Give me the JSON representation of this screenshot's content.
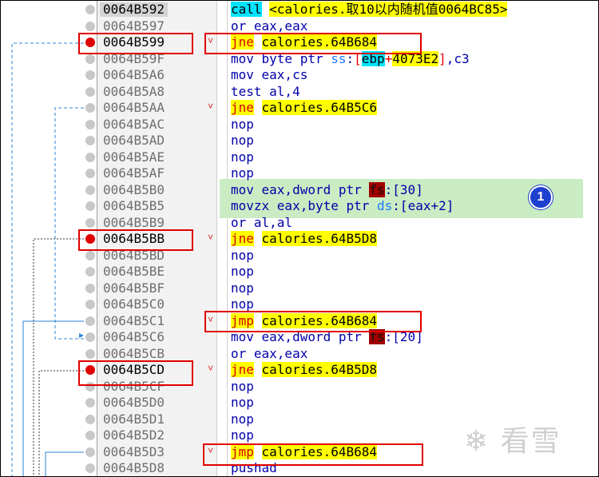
{
  "disasm": {
    "rows": [
      {
        "addr": "0064B592",
        "bp": "grey",
        "cur": true,
        "mark": "",
        "ins": [
          {
            "t": "call",
            "c": "call"
          },
          {
            "t": " ",
            "c": "plain"
          },
          {
            "t": "<calories.取10以内随机值0064BC85>",
            "c": "tgt"
          }
        ]
      },
      {
        "addr": "0064B597",
        "bp": "grey",
        "mark": "",
        "ins": [
          {
            "t": "or eax,eax",
            "c": "m"
          }
        ]
      },
      {
        "addr": "0064B599",
        "bp": "red",
        "mark": "˅",
        "ins": [
          {
            "t": "jne",
            "c": "jmp"
          },
          {
            "t": " ",
            "c": "plain"
          },
          {
            "t": "calories.64B684",
            "c": "tgt2"
          }
        ]
      },
      {
        "addr": "0064B59F",
        "bp": "grey",
        "mark": "",
        "ins": [
          {
            "t": "mov byte ptr ",
            "c": "m"
          },
          {
            "t": "ss",
            "c": "seg"
          },
          {
            "t": ":",
            "c": "m"
          },
          {
            "t": "[",
            "c": "br"
          },
          {
            "t": "ebp",
            "c": "reg"
          },
          {
            "t": "+",
            "c": "br"
          },
          {
            "t": "4073E2",
            "c": "off"
          },
          {
            "t": "]",
            "c": "br"
          },
          {
            "t": ",c3",
            "c": "m"
          }
        ]
      },
      {
        "addr": "0064B5A6",
        "bp": "grey",
        "mark": "",
        "ins": [
          {
            "t": "mov eax,cs",
            "c": "m"
          }
        ]
      },
      {
        "addr": "0064B5A8",
        "bp": "grey",
        "mark": "",
        "ins": [
          {
            "t": "test al,4",
            "c": "m"
          }
        ]
      },
      {
        "addr": "0064B5AA",
        "bp": "grey",
        "mark": "˅",
        "ins": [
          {
            "t": "jne",
            "c": "jmp"
          },
          {
            "t": " ",
            "c": "plain"
          },
          {
            "t": "calories.64B5C6",
            "c": "tgt2"
          }
        ]
      },
      {
        "addr": "0064B5AC",
        "bp": "grey",
        "mark": "",
        "ins": [
          {
            "t": "nop",
            "c": "m"
          }
        ]
      },
      {
        "addr": "0064B5AD",
        "bp": "grey",
        "mark": "",
        "ins": [
          {
            "t": "nop",
            "c": "m"
          }
        ]
      },
      {
        "addr": "0064B5AE",
        "bp": "grey",
        "mark": "",
        "ins": [
          {
            "t": "nop",
            "c": "m"
          }
        ]
      },
      {
        "addr": "0064B5AF",
        "bp": "grey",
        "mark": "",
        "ins": [
          {
            "t": "nop",
            "c": "m"
          }
        ]
      },
      {
        "addr": "0064B5B0",
        "bp": "grey",
        "mark": "",
        "ins": [
          {
            "t": "mov eax,dword ptr ",
            "c": "m"
          },
          {
            "t": "fs",
            "c": "fs"
          },
          {
            "t": ":[30]",
            "c": "m"
          }
        ]
      },
      {
        "addr": "0064B5B5",
        "bp": "grey",
        "mark": "",
        "ins": [
          {
            "t": "movzx eax,byte ptr ",
            "c": "m"
          },
          {
            "t": "ds",
            "c": "seg"
          },
          {
            "t": ":[eax+2]",
            "c": "m"
          }
        ]
      },
      {
        "addr": "0064B5B9",
        "bp": "grey",
        "mark": "",
        "ins": [
          {
            "t": "or al,al",
            "c": "m"
          }
        ]
      },
      {
        "addr": "0064B5BB",
        "bp": "red",
        "mark": "˅",
        "ins": [
          {
            "t": "jne",
            "c": "jmp"
          },
          {
            "t": " ",
            "c": "plain"
          },
          {
            "t": "calories.64B5D8",
            "c": "tgt2"
          }
        ]
      },
      {
        "addr": "0064B5BD",
        "bp": "grey",
        "mark": "",
        "ins": [
          {
            "t": "nop",
            "c": "m"
          }
        ]
      },
      {
        "addr": "0064B5BE",
        "bp": "grey",
        "mark": "",
        "ins": [
          {
            "t": "nop",
            "c": "m"
          }
        ]
      },
      {
        "addr": "0064B5BF",
        "bp": "grey",
        "mark": "",
        "ins": [
          {
            "t": "nop",
            "c": "m"
          }
        ]
      },
      {
        "addr": "0064B5C0",
        "bp": "grey",
        "mark": "",
        "ins": [
          {
            "t": "nop",
            "c": "m"
          }
        ]
      },
      {
        "addr": "0064B5C1",
        "bp": "grey",
        "mark": "˅",
        "ins": [
          {
            "t": "jmp",
            "c": "jmp"
          },
          {
            "t": " ",
            "c": "plain"
          },
          {
            "t": "calories.64B684",
            "c": "tgt2"
          }
        ]
      },
      {
        "addr": "0064B5C6",
        "bp": "grey",
        "mark": "",
        "ins": [
          {
            "t": "mov eax,dword ptr ",
            "c": "m"
          },
          {
            "t": "fs",
            "c": "fs"
          },
          {
            "t": ":[20]",
            "c": "m"
          }
        ]
      },
      {
        "addr": "0064B5CB",
        "bp": "grey",
        "mark": "",
        "ins": [
          {
            "t": "or eax,eax",
            "c": "m"
          }
        ]
      },
      {
        "addr": "0064B5CD",
        "bp": "red",
        "mark": "˅",
        "ins": [
          {
            "t": "jne",
            "c": "jmp"
          },
          {
            "t": " ",
            "c": "plain"
          },
          {
            "t": "calories.64B5D8",
            "c": "tgt2"
          }
        ]
      },
      {
        "addr": "0064B5CF",
        "bp": "grey",
        "mark": "",
        "ins": [
          {
            "t": "nop",
            "c": "m"
          }
        ]
      },
      {
        "addr": "0064B5D0",
        "bp": "grey",
        "mark": "",
        "ins": [
          {
            "t": "nop",
            "c": "m"
          }
        ]
      },
      {
        "addr": "0064B5D1",
        "bp": "grey",
        "mark": "",
        "ins": [
          {
            "t": "nop",
            "c": "m"
          }
        ]
      },
      {
        "addr": "0064B5D2",
        "bp": "grey",
        "mark": "",
        "ins": [
          {
            "t": "nop",
            "c": "m"
          }
        ]
      },
      {
        "addr": "0064B5D3",
        "bp": "grey",
        "mark": "˅",
        "ins": [
          {
            "t": "jmp",
            "c": "jmp"
          },
          {
            "t": " ",
            "c": "plain"
          },
          {
            "t": "calories.64B684",
            "c": "tgt2"
          }
        ]
      },
      {
        "addr": "0064B5D8",
        "bp": "grey",
        "mark": "",
        "ins": [
          {
            "t": "pushad",
            "c": "m"
          }
        ]
      }
    ]
  },
  "annotation": {
    "badge": "1"
  },
  "watermark": {
    "text": "看雪"
  },
  "colors": {
    "breakpoint": "#e00000",
    "jump_bg": "#ffff00",
    "highlight": "#c9ecc2",
    "box": "#e00000"
  }
}
